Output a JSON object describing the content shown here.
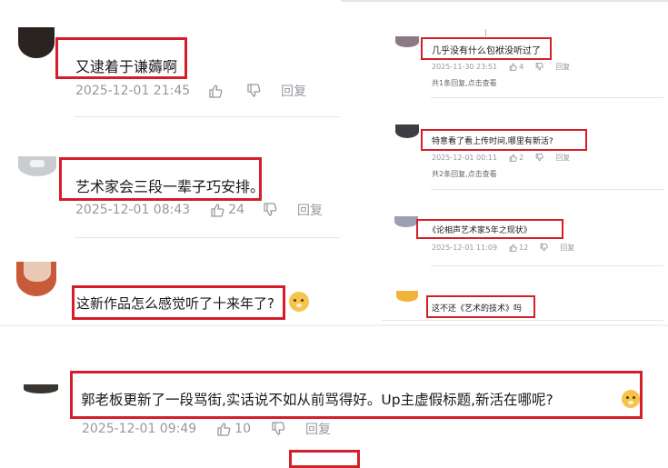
{
  "left_comments": [
    {
      "text": "又逮着于谦薅啊",
      "time": "2025-12-01 21:45",
      "likes": "",
      "reply": "回复"
    },
    {
      "text": "艺术家会三段一辈子巧安排。",
      "time": "2025-12-01 08:43",
      "likes": "24",
      "reply": "回复"
    },
    {
      "text": "这新作品怎么感觉听了十来年了?",
      "time": "",
      "likes": "",
      "reply": ""
    }
  ],
  "right_comments": [
    {
      "text": "几乎没有什么包袱没听过了",
      "time": "2025-11-30 23:51",
      "likes": "4",
      "reply": "回复",
      "sub": "共1条回复,点击查看"
    },
    {
      "text": "特意看了看上传时间,哪里有新活?",
      "time": "2025-12-01 00:11",
      "likes": "2",
      "reply": "回复",
      "sub": "共2条回复,点击查看"
    },
    {
      "text": "《论相声艺术家5年之现状》",
      "time": "2025-12-01 11:09",
      "likes": "12",
      "reply": "回复",
      "sub": ""
    },
    {
      "text": "这不还《艺术的技术》吗",
      "time": "",
      "likes": "",
      "reply": "",
      "sub": ""
    }
  ],
  "bottom_comment": {
    "text": "郭老板更新了一段骂街,实话说不如从前骂得好。Up主虚假标题,新活在哪呢?",
    "time": "2025-12-01 09:49",
    "likes": "10",
    "reply": "回复"
  },
  "icons": [
    "thumb-up-icon",
    "thumb-down-icon",
    "dog-emoji-icon"
  ],
  "colors": {
    "highlight_box": "#d41f2b",
    "meta_text": "#9499a0",
    "text": "#18191c"
  }
}
